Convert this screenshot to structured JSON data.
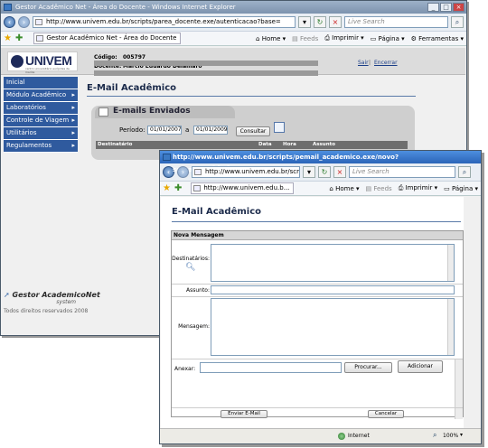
{
  "back_window": {
    "title": "Gestor Acadêmico Net - Área do Docente - Windows Internet Explorer",
    "address": "http://www.univem.edu.br/scripts/parea_docente.exe/autenticacao?base=",
    "search_placeholder": "Live Search",
    "tab_label": "Gestor Acadêmico Net - Área do Docente",
    "toolbar": {
      "home": "Home",
      "feeds": "Feeds",
      "print": "Imprimir",
      "page": "Página",
      "tools": "Ferramentas"
    },
    "page": {
      "logo_text": "UNIVEM",
      "logo_tagline": "centro universitário eurípides de marília",
      "codigo_label": "Código:",
      "codigo_value": "005797",
      "docente_label": "Docente:",
      "docente_value": "Marcio Eduardo Delamaro",
      "sair": "Sair",
      "encerrar": "Encerrar",
      "menu": [
        {
          "label": "Inicial",
          "arrow": ""
        },
        {
          "label": "Módulo Acadêmico",
          "arrow": "▸"
        },
        {
          "label": "Laboratórios",
          "arrow": "▸"
        },
        {
          "label": "Controle de Viagem",
          "arrow": "▸"
        },
        {
          "label": "Utilitários",
          "arrow": "▸"
        },
        {
          "label": "Regulamentos",
          "arrow": "▸"
        }
      ],
      "brand": "Gestor AcademicoNet",
      "brand_sub": "system",
      "copyright": "Todos direitos reservados 2008",
      "title": "E-Mail Acadêmico",
      "sent_box_title": "E-mails Enviados",
      "period_label": "Período:",
      "date_from": "01/01/2007",
      "date_sep": "a",
      "date_to": "01/01/2009",
      "consultar": "Consultar",
      "columns": [
        "Destinatário",
        "Data",
        "Hora",
        "Assunto"
      ]
    }
  },
  "front_window": {
    "title": "http://www.univem.edu.br/scripts/pemail_academico.exe/novo?sessao=ãBÃÕãÕß/tipo_u...",
    "address": "http://www.univem.edu.br/scripts/p",
    "search_placeholder": "Live Search",
    "tab_label": "http://www.univem.edu.b...",
    "toolbar": {
      "home": "Home",
      "feeds": "Feeds",
      "print": "Imprimir",
      "page": "Página"
    },
    "page": {
      "title": "E-Mail Acadêmico",
      "form_header": "Nova Mensagem",
      "destinatarios_label": "Destinatários:",
      "assunto_label": "Assunto:",
      "mensagem_label": "Mensagem:",
      "anexar_label": "Anexar:",
      "procurar": "Procurar...",
      "adicionar": "Adicionar",
      "enviar": "Enviar E-Mail",
      "cancelar": "Cancelar"
    },
    "status": {
      "zone": "Internet",
      "zoom": "100%"
    }
  }
}
